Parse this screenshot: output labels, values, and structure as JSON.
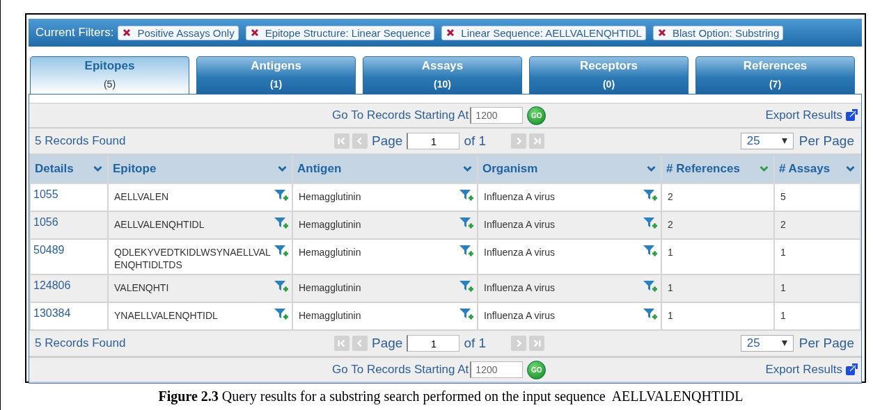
{
  "filters": {
    "label": "Current Filters:",
    "items": [
      {
        "text": "Positive Assays Only"
      },
      {
        "text": "Epitope Structure: Linear Sequence"
      },
      {
        "text": "Linear Sequence: AELLVALENQHTIDL"
      },
      {
        "text": "Blast Option: Substring"
      }
    ]
  },
  "tabs": [
    {
      "label": "Epitopes",
      "count": "(5)",
      "selected": true
    },
    {
      "label": "Antigens",
      "count": "(1)",
      "selected": false
    },
    {
      "label": "Assays",
      "count": "(10)",
      "selected": false
    },
    {
      "label": "Receptors",
      "count": "(0)",
      "selected": false
    },
    {
      "label": "References",
      "count": "(7)",
      "selected": false
    }
  ],
  "top_goto": {
    "label": "Go To Records Starting At",
    "value": "1200",
    "button": "GO",
    "export": "Export Results"
  },
  "top_pager": {
    "records": "5 Records Found",
    "page_label": "Page",
    "page_value": "1",
    "of": "of 1",
    "nav_disabled": true,
    "per_page_value": "25",
    "per_page_label": "Per Page"
  },
  "table": {
    "columns": [
      {
        "label": "Details",
        "sorted": false,
        "filterable": false
      },
      {
        "label": "Epitope",
        "sorted": false,
        "filterable": true
      },
      {
        "label": "Antigen",
        "sorted": false,
        "filterable": true
      },
      {
        "label": "Organism",
        "sorted": false,
        "filterable": true
      },
      {
        "label": "# References",
        "sorted": true,
        "filterable": false
      },
      {
        "label": "# Assays",
        "sorted": false,
        "filterable": false
      }
    ],
    "rows": [
      [
        "1055",
        "AELLVALEN",
        "Hemagglutinin",
        "Influenza A virus",
        "2",
        "5"
      ],
      [
        "1056",
        "AELLVALENQHTIDL",
        "Hemagglutinin",
        "Influenza A virus",
        "2",
        "2"
      ],
      [
        "50489",
        "QDLEKYVEDTKIDLWSYNAELLVALENQHTIDLTDS",
        "Hemagglutinin",
        "Influenza A virus",
        "1",
        "1"
      ],
      [
        "124806",
        "VALENQHTI",
        "Hemagglutinin",
        "Influenza A virus",
        "1",
        "1"
      ],
      [
        "130384",
        "YNAELLVALENQHTIDL",
        "Hemagglutinin",
        "Influenza A virus",
        "1",
        "1"
      ]
    ]
  },
  "bottom_pager": {
    "records": "5 Records Found",
    "page_label": "Page",
    "page_value": "1",
    "of": "of 1",
    "nav_disabled": true,
    "per_page_value": "25",
    "per_page_label": "Per Page"
  },
  "bottom_goto": {
    "label": "Go To Records Starting At",
    "value": "1200",
    "button": "GO",
    "export": "Export Results"
  },
  "caption": "**Figure 2.3** Query results for a substring search performed on the input sequence  AELLVALENQHTIDL"
}
